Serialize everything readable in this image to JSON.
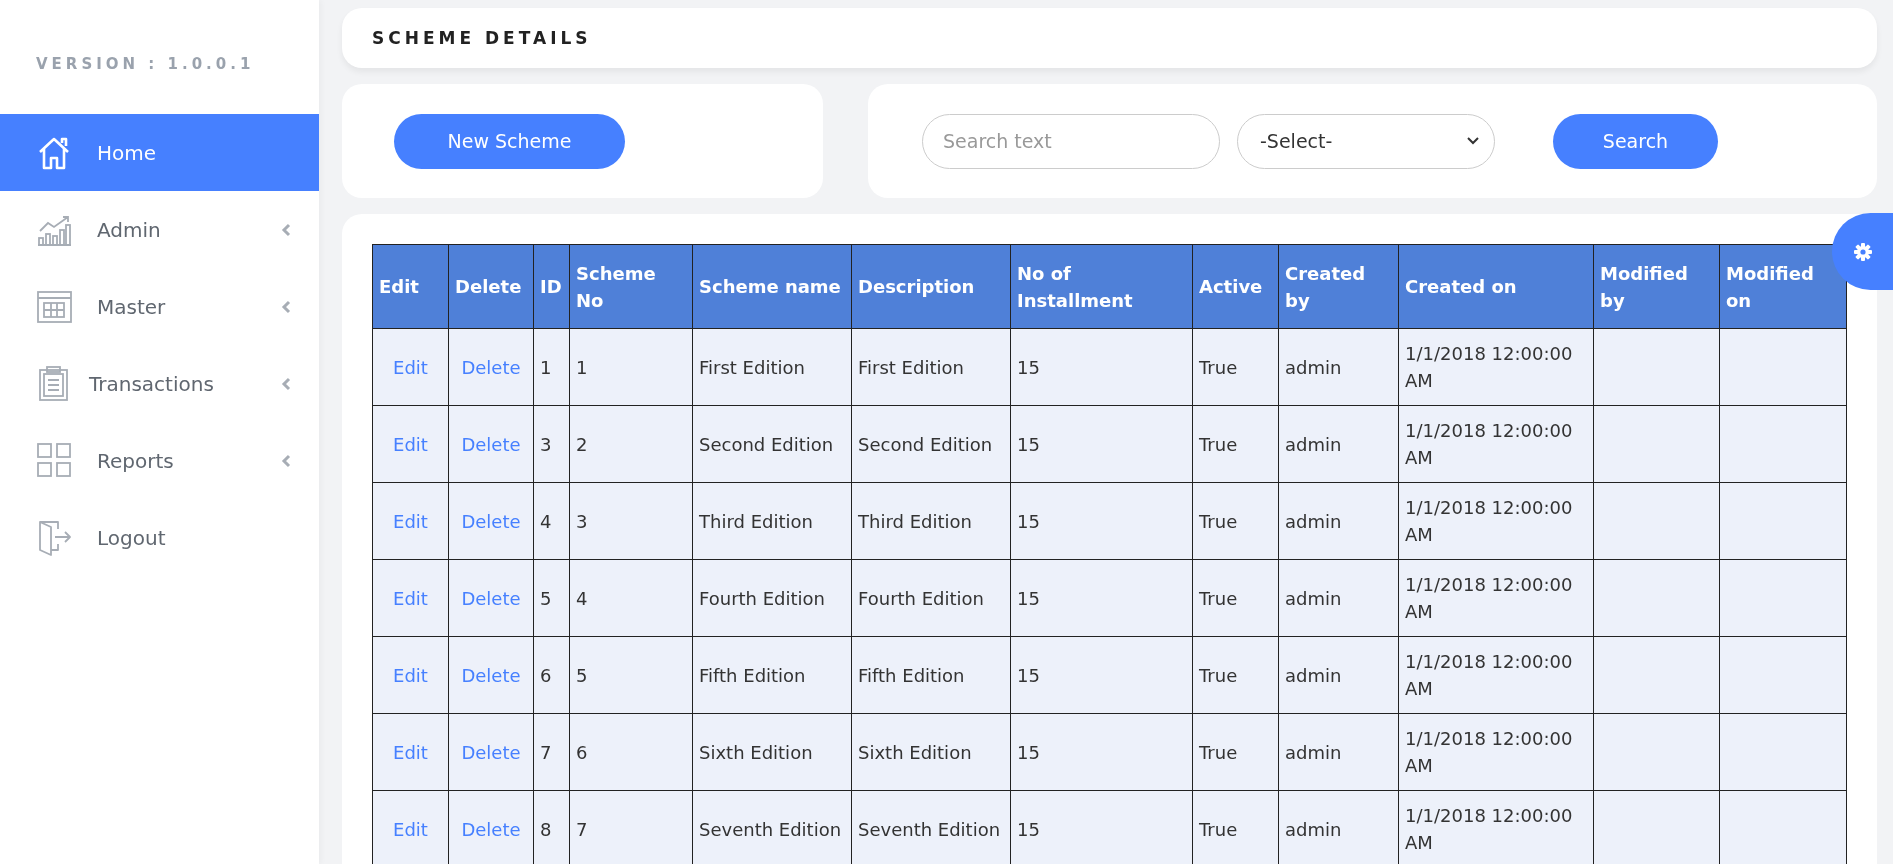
{
  "sidebar": {
    "version": "VERSION : 1.0.0.1",
    "items": [
      {
        "label": "Home",
        "kind": "home",
        "selected": true,
        "has_submenu": false
      },
      {
        "label": "Admin",
        "kind": "chart",
        "selected": false,
        "has_submenu": true
      },
      {
        "label": "Master",
        "kind": "grid-window",
        "selected": false,
        "has_submenu": true
      },
      {
        "label": "Transactions",
        "kind": "clipboard",
        "selected": false,
        "has_submenu": true
      },
      {
        "label": "Reports",
        "kind": "squares",
        "selected": false,
        "has_submenu": true
      },
      {
        "label": "Logout",
        "kind": "door",
        "selected": false,
        "has_submenu": false
      }
    ]
  },
  "page_title": "SCHEME DETAILS",
  "new_button": "New Scheme",
  "search": {
    "placeholder": "Search text",
    "select_value": "-Select-",
    "button": "Search"
  },
  "table": {
    "columns": [
      "Edit",
      "Delete",
      "ID",
      "Scheme No",
      "Scheme name",
      "Description",
      "No of Installment",
      "Active",
      "Created by",
      "Created on",
      "Modified by",
      "Modified on"
    ],
    "rows": [
      {
        "edit": "Edit",
        "delete": "Delete",
        "id": "1",
        "scheme_no": "1",
        "scheme_name": "First Edition",
        "description": "First Edition",
        "installments": "15",
        "active": "True",
        "created_by": "admin",
        "created_on": "1/1/2018 12:00:00 AM"
      },
      {
        "edit": "Edit",
        "delete": "Delete",
        "id": "3",
        "scheme_no": "2",
        "scheme_name": "Second Edition",
        "description": "Second Edition",
        "installments": "15",
        "active": "True",
        "created_by": "admin",
        "created_on": "1/1/2018 12:00:00 AM"
      },
      {
        "edit": "Edit",
        "delete": "Delete",
        "id": "4",
        "scheme_no": "3",
        "scheme_name": "Third Edition",
        "description": "Third Edition",
        "installments": "15",
        "active": "True",
        "created_by": "admin",
        "created_on": "1/1/2018 12:00:00 AM"
      },
      {
        "edit": "Edit",
        "delete": "Delete",
        "id": "5",
        "scheme_no": "4",
        "scheme_name": "Fourth Edition",
        "description": "Fourth Edition",
        "installments": "15",
        "active": "True",
        "created_by": "admin",
        "created_on": "1/1/2018 12:00:00 AM"
      },
      {
        "edit": "Edit",
        "delete": "Delete",
        "id": "6",
        "scheme_no": "5",
        "scheme_name": "Fifth Edition",
        "description": "Fifth Edition",
        "installments": "15",
        "active": "True",
        "created_by": "admin",
        "created_on": "1/1/2018 12:00:00 AM"
      },
      {
        "edit": "Edit",
        "delete": "Delete",
        "id": "7",
        "scheme_no": "6",
        "scheme_name": "Sixth Edition",
        "description": "Sixth Edition",
        "installments": "15",
        "active": "True",
        "created_by": "admin",
        "created_on": "1/1/2018 12:00:00 AM"
      },
      {
        "edit": "Edit",
        "delete": "Delete",
        "id": "8",
        "scheme_no": "7",
        "scheme_name": "Seventh Edition",
        "description": "Seventh Edition",
        "installments": "15",
        "active": "True",
        "created_by": "admin",
        "created_on": "1/1/2018 12:00:00 AM"
      }
    ]
  }
}
